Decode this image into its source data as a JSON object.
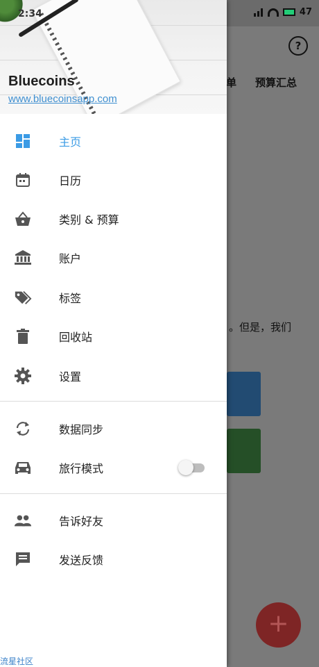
{
  "status_bar": {
    "time": "2:34",
    "battery": "47"
  },
  "background_app": {
    "help_icon_label": "?",
    "tabs": [
      "单",
      "预算汇总"
    ],
    "body_text": "。但是，我们",
    "fab_label": "+"
  },
  "drawer": {
    "app_name": "Bluecoins",
    "website": "www.bluecoinsapp.com",
    "items": [
      {
        "label": "主页",
        "icon": "dashboard-icon",
        "active": true
      },
      {
        "label": "日历",
        "icon": "calendar-icon"
      },
      {
        "label": "类别 & 预算",
        "icon": "basket-icon"
      },
      {
        "label": "账户",
        "icon": "bank-icon"
      },
      {
        "label": "标签",
        "icon": "tags-icon"
      },
      {
        "label": "回收站",
        "icon": "trash-icon"
      },
      {
        "label": "设置",
        "icon": "gear-icon"
      },
      {
        "label": "数据同步",
        "icon": "sync-icon"
      },
      {
        "label": "旅行模式",
        "icon": "car-icon",
        "toggle": false
      },
      {
        "label": "告诉好友",
        "icon": "people-icon"
      },
      {
        "label": "发送反馈",
        "icon": "feedback-icon"
      }
    ]
  },
  "watermark": "流星社区",
  "colors": {
    "accent": "#3b9be5",
    "fab": "#c62828",
    "icon": "#555555"
  }
}
